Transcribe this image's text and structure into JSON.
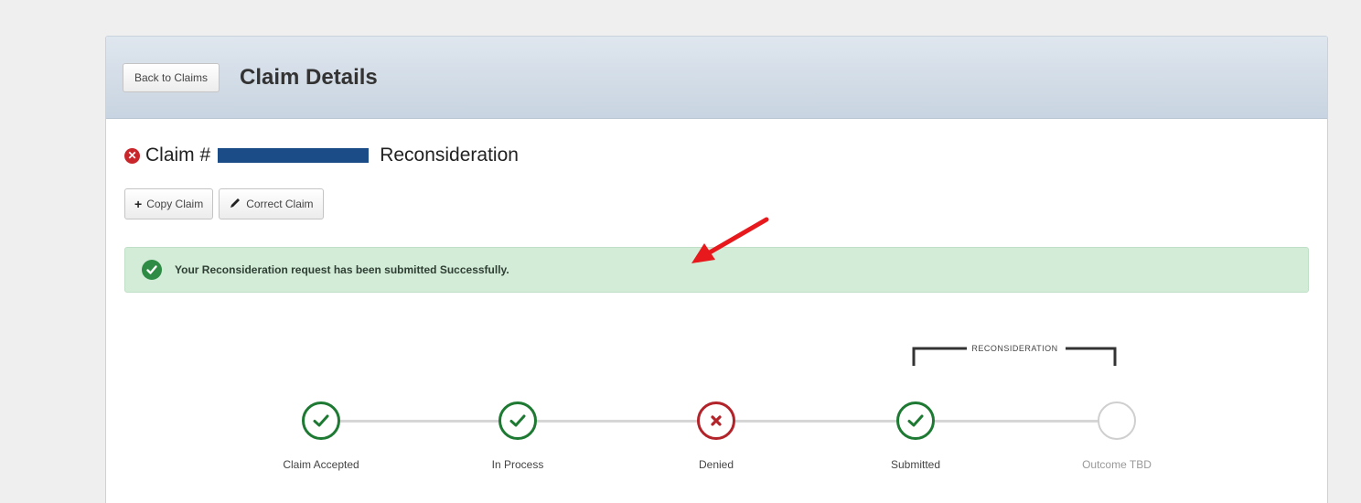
{
  "header": {
    "back_label": "Back to Claims",
    "title": "Claim Details"
  },
  "claim": {
    "prefix": "Claim #",
    "type": "Reconsideration",
    "status_icon": "error-x-icon"
  },
  "actions": {
    "copy_label": "Copy Claim",
    "correct_label": "Correct Claim"
  },
  "alert": {
    "message": "Your Reconsideration request has been submitted Successfully.",
    "icon": "check-circle-icon"
  },
  "tracker": {
    "group_label": "RECONSIDERATION",
    "steps": [
      {
        "label": "Claim Accepted",
        "state": "complete"
      },
      {
        "label": "In Process",
        "state": "complete"
      },
      {
        "label": "Denied",
        "state": "denied"
      },
      {
        "label": "Submitted",
        "state": "complete"
      },
      {
        "label": "Outcome TBD",
        "state": "pending"
      }
    ]
  },
  "colors": {
    "success": "#1e7a33",
    "danger": "#b3232a",
    "redaction": "#1b4c87",
    "annotation_arrow": "#e8191c"
  }
}
